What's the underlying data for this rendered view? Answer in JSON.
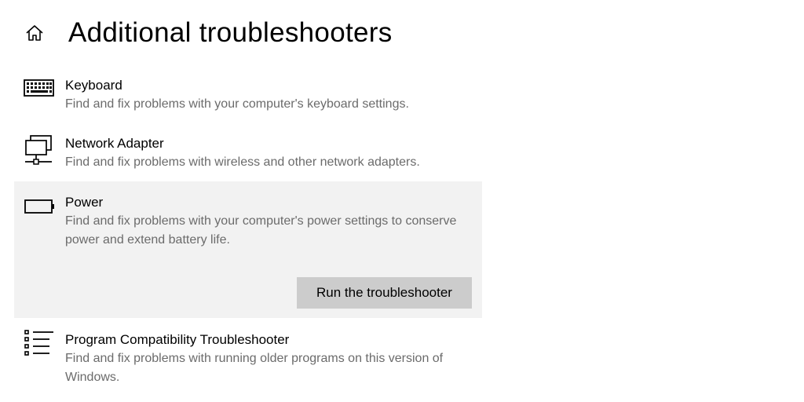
{
  "header": {
    "home_icon": "home-icon",
    "title": "Additional troubleshooters"
  },
  "items": [
    {
      "icon": "keyboard-icon",
      "title": "Keyboard",
      "description": "Find and fix problems with your computer's keyboard settings."
    },
    {
      "icon": "network-adapter-icon",
      "title": "Network Adapter",
      "description": "Find and fix problems with wireless and other network adapters."
    },
    {
      "icon": "battery-icon",
      "title": "Power",
      "description": "Find and fix problems with your computer's power settings to conserve power and extend battery life.",
      "selected": true,
      "action_label": "Run the troubleshooter"
    },
    {
      "icon": "list-icon",
      "title": "Program Compatibility Troubleshooter",
      "description": "Find and fix problems with running older programs on this version of Windows."
    }
  ],
  "colors": {
    "selected_background": "#f2f2f2",
    "button_background": "#cccccc",
    "description_text": "#6b6b6b"
  }
}
